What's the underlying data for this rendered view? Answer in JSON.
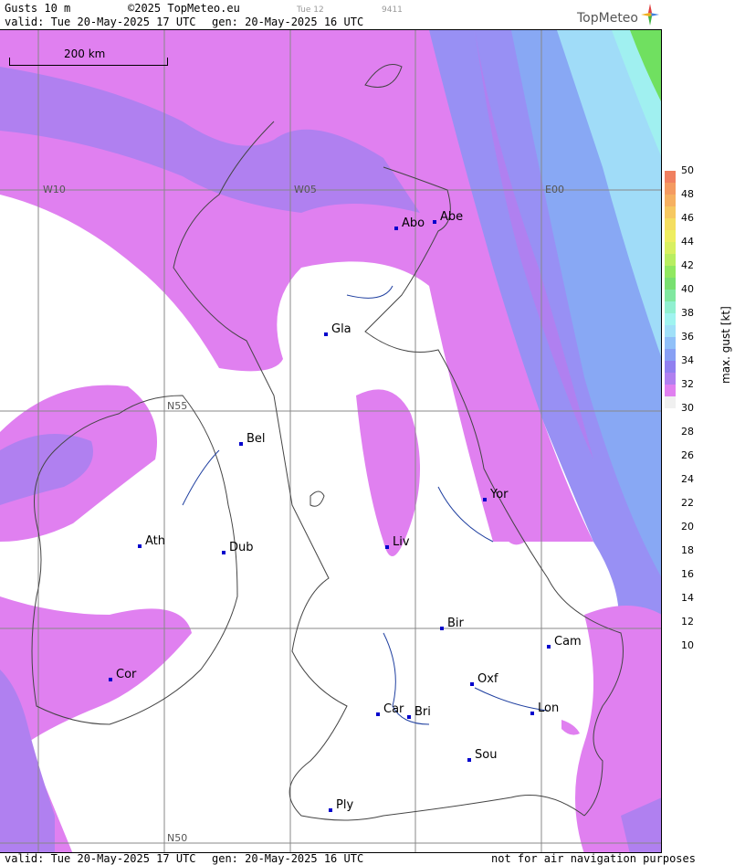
{
  "header": {
    "product": "Gusts 10 m",
    "copyright": "©2025 TopMeteo.eu",
    "step": "Tue 12",
    "code": "9411",
    "valid": "valid:  Tue  20-May-2025  17 UTC",
    "gen": "gen: 20-May-2025 16 UTC",
    "logo": "TopMeteo"
  },
  "footer": {
    "valid": "valid:  Tue  20-May-2025  17 UTC",
    "gen": "gen: 20-May-2025 16 UTC",
    "note": "not for air navigation purposes"
  },
  "map": {
    "scale": "200 km",
    "grid_labels": {
      "w10": "W10",
      "w05": "W05",
      "e00": "E00",
      "n55": "N55",
      "n50": "N50"
    },
    "cities": [
      {
        "name": "Abo"
      },
      {
        "name": "Abe"
      },
      {
        "name": "Gla"
      },
      {
        "name": "Bel"
      },
      {
        "name": "Yor"
      },
      {
        "name": "Ath"
      },
      {
        "name": "Dub"
      },
      {
        "name": "Liv"
      },
      {
        "name": "Bir"
      },
      {
        "name": "Cam"
      },
      {
        "name": "Cor"
      },
      {
        "name": "Oxf"
      },
      {
        "name": "Car"
      },
      {
        "name": "Bri"
      },
      {
        "name": "Lon"
      },
      {
        "name": "Sou"
      },
      {
        "name": "Ply"
      }
    ]
  },
  "legend": {
    "title": "max. gust [kt]",
    "labels": [
      "50",
      "48",
      "46",
      "44",
      "42",
      "40",
      "38",
      "36",
      "34",
      "32",
      "30",
      "28",
      "26",
      "24",
      "22",
      "20",
      "18",
      "16",
      "14",
      "12",
      "10"
    ],
    "colors": [
      "#f08060",
      "#f49a60",
      "#f6b060",
      "#f6c860",
      "#f4de60",
      "#eeee60",
      "#d8f060",
      "#b8ee60",
      "#90e860",
      "#78e070",
      "#80e8a0",
      "#90f0d0",
      "#a0f4f0",
      "#a0e0f8",
      "#90c0f8",
      "#88a0f4",
      "#9080f0",
      "#b080f0",
      "#e080f0",
      "#f0f0f0"
    ]
  }
}
